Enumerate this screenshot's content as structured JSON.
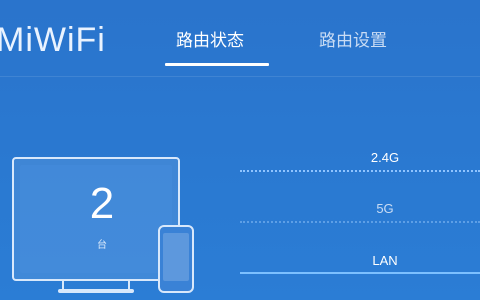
{
  "header": {
    "logo_text": "MiWiFi",
    "tabs": [
      {
        "label": "路由状态",
        "active": true
      },
      {
        "label": "路由设置",
        "active": false
      }
    ]
  },
  "devices": {
    "count": "2",
    "unit": "台"
  },
  "connections": [
    {
      "label": "2.4G",
      "line_style": "dotted"
    },
    {
      "label": "5G",
      "line_style": "dotted"
    },
    {
      "label": "LAN",
      "line_style": "solid"
    }
  ],
  "colors": {
    "background": "#2a78d0",
    "text": "#ffffff",
    "inactive_text": "#c9dcf4",
    "line": "#8fc4ff"
  }
}
